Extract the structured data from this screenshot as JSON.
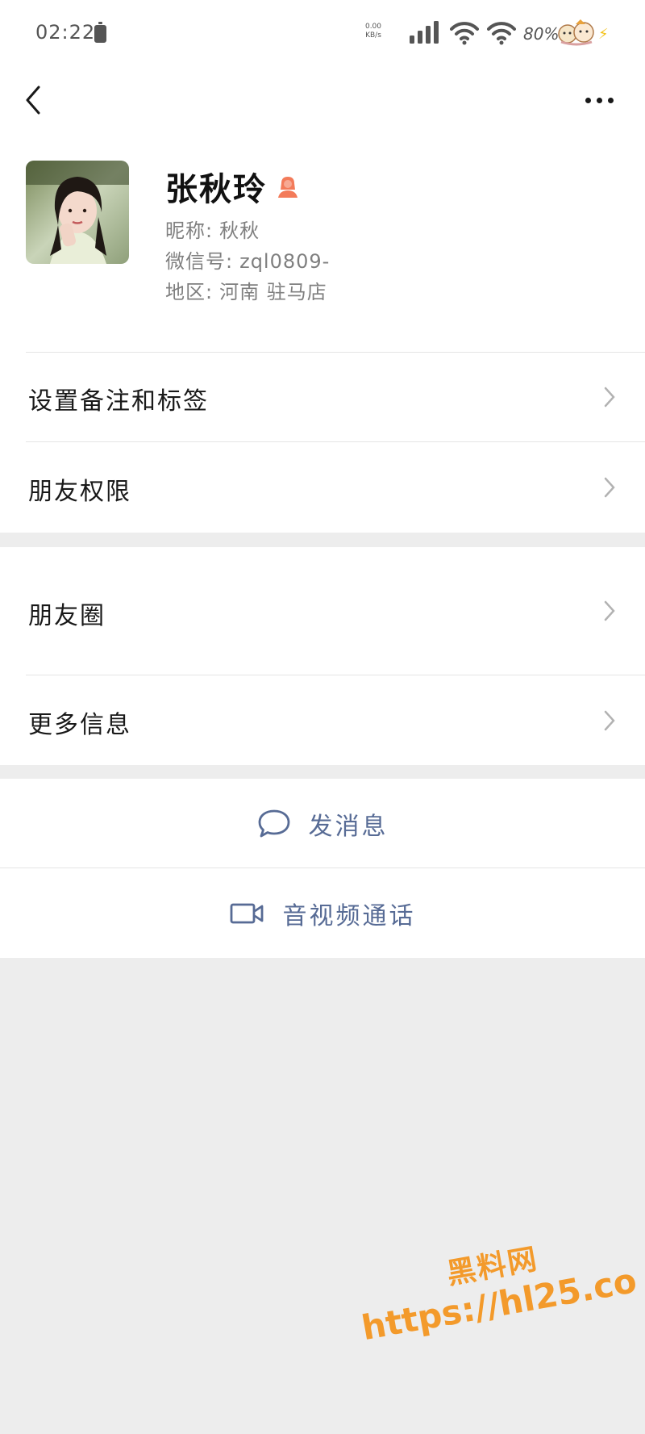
{
  "status_bar": {
    "time": "02:22",
    "net_speed_value": "0.00",
    "net_speed_unit": "KB/s",
    "battery_percent": "80%"
  },
  "nav": {
    "back_icon": "chevron-left-icon",
    "more_icon": "more-horizontal-icon"
  },
  "profile": {
    "name": "张秋玲",
    "gender_icon": "female-icon",
    "gender_color": "#f37b5a",
    "nickname_label": "昵称:",
    "nickname": "秋秋",
    "wechat_id_label": "微信号:",
    "wechat_id": "zql0809-",
    "region_label": "地区:",
    "region": "河南 驻马店"
  },
  "menu_group_1": [
    {
      "label": "设置备注和标签"
    },
    {
      "label": "朋友权限"
    }
  ],
  "menu_group_2": [
    {
      "label": "朋友圈"
    },
    {
      "label": "更多信息"
    }
  ],
  "actions": {
    "send_message": "发消息",
    "video_call": "音视频通话",
    "action_color": "#576b95"
  },
  "watermark": {
    "line1": "黑料网",
    "line2": "https://hl25.co"
  }
}
